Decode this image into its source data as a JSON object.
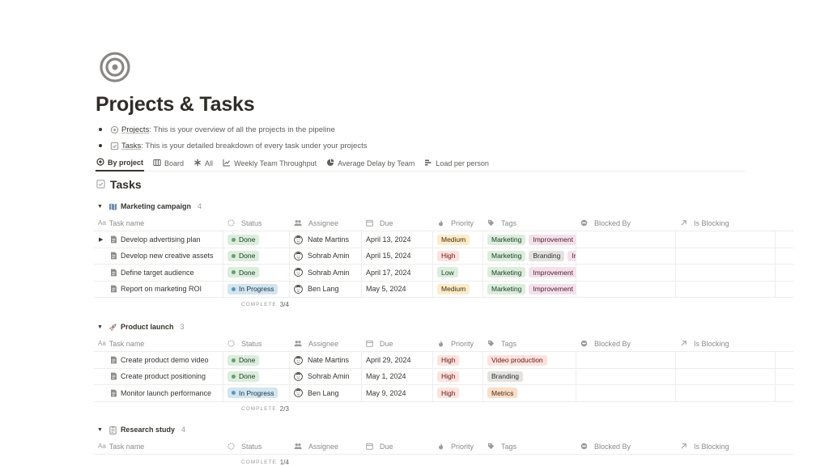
{
  "page": {
    "icon": "target-icon",
    "title": "Projects & Tasks",
    "bullets": [
      {
        "icon": "projects-icon",
        "link": "Projects",
        "text": ": This is your overview of all the projects in the pipeline"
      },
      {
        "icon": "tasks-icon",
        "link": "Tasks",
        "text": ": This is your detailed breakdown of every task under your projects"
      }
    ]
  },
  "views": [
    {
      "icon": "target-icon",
      "label": "By project",
      "active": true
    },
    {
      "icon": "board-icon",
      "label": "Board"
    },
    {
      "icon": "asterisk-icon",
      "label": "All"
    },
    {
      "icon": "line-chart-icon",
      "label": "Weekly Team Throughput"
    },
    {
      "icon": "pie-chart-icon",
      "label": "Average Delay by Team"
    },
    {
      "icon": "bar-chart-icon",
      "label": "Load per person"
    }
  ],
  "database": {
    "icon": "checkbox-icon",
    "title": "Tasks"
  },
  "columns": {
    "name": "Task name",
    "status": "Status",
    "assignee": "Assignee",
    "due": "Due",
    "priority": "Priority",
    "tags": "Tags",
    "blocked_by": "Blocked By",
    "is_blocking": "Is Blocking"
  },
  "complete_label": "COMPLETE",
  "groups": [
    {
      "icon": "map-icon",
      "name": "Marketing campaign",
      "count": "4",
      "complete": "3/4",
      "rows": [
        {
          "name": "Develop advertising plan",
          "expandable": true,
          "status": "Done",
          "assignee": "Nate Martins",
          "due": "April 13, 2024",
          "priority": "Medium",
          "tags": [
            {
              "t": "Marketing",
              "c": "green"
            },
            {
              "t": "Improvement",
              "c": "pink"
            }
          ]
        },
        {
          "name": "Develop new creative assets",
          "status": "Done",
          "assignee": "Sohrab Amin",
          "due": "April 15, 2024",
          "priority": "High",
          "tags": [
            {
              "t": "Marketing",
              "c": "green"
            },
            {
              "t": "Branding",
              "c": "gray"
            },
            {
              "t": "Im",
              "c": "pink"
            }
          ]
        },
        {
          "name": "Define target audience",
          "status": "Done",
          "assignee": "Sohrab Amin",
          "due": "April 17, 2024",
          "priority": "Low",
          "tags": [
            {
              "t": "Marketing",
              "c": "green"
            },
            {
              "t": "Improvement",
              "c": "pink"
            }
          ]
        },
        {
          "name": "Report on marketing ROI",
          "status": "In Progress",
          "assignee": "Ben Lang",
          "due": "May 5, 2024",
          "priority": "Medium",
          "tags": [
            {
              "t": "Marketing",
              "c": "green"
            },
            {
              "t": "Improvement",
              "c": "pink"
            }
          ]
        }
      ]
    },
    {
      "icon": "rocket-icon",
      "name": "Product launch",
      "count": "3",
      "complete": "2/3",
      "rows": [
        {
          "name": "Create product demo video",
          "status": "Done",
          "assignee": "Nate Martins",
          "due": "April 29, 2024",
          "priority": "High",
          "tags": [
            {
              "t": "Video production",
              "c": "red"
            }
          ]
        },
        {
          "name": "Create product positioning",
          "status": "Done",
          "assignee": "Sohrab Amin",
          "due": "May 1, 2024",
          "priority": "High",
          "tags": [
            {
              "t": "Branding",
              "c": "gray"
            }
          ]
        },
        {
          "name": "Monitor launch performance",
          "status": "In Progress",
          "assignee": "Ben Lang",
          "due": "May 9, 2024",
          "priority": "High",
          "tags": [
            {
              "t": "Metrics",
              "c": "orange"
            }
          ]
        }
      ]
    },
    {
      "icon": "clipboard-icon",
      "name": "Research study",
      "count": "4",
      "complete": "1/4",
      "rows": []
    }
  ]
}
